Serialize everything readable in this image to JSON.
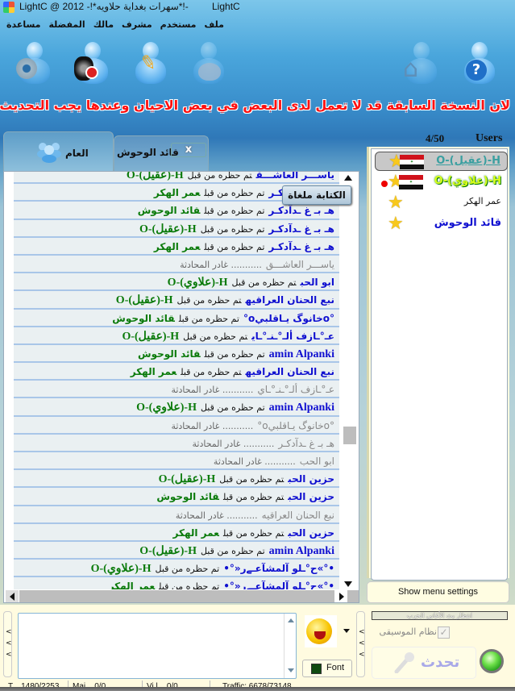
{
  "window": {
    "title": "LightC @ 2012  -!*سهرات بغداية حلاويه*!-",
    "app_name": "LightC"
  },
  "menu": {
    "items": [
      "ملف",
      "مستخدم",
      "مشرف",
      "مالك",
      "المفضلة",
      "مساعدة"
    ]
  },
  "toolbar": {
    "icons": [
      "webcam-icon",
      "speaker-muted-icon",
      "edit-profile-icon",
      "theme-palette-icon",
      "home-icon",
      "help-icon"
    ]
  },
  "marquee": {
    "text": "لان النسخة السابقة قد لا تعمل لدى البعض في بعض الاحيان وعندها يجب التحديث يدويا   اد"
  },
  "tabs": {
    "general_label": "العام",
    "private_label": "قائد الوحوش",
    "close_label": "x"
  },
  "chat": {
    "writing_disabled_label": "الكتابة ملغاة",
    "rows": [
      {
        "who": "ياســـر العاشـــق",
        "action": "تم حظره من قبل",
        "by": "H-(عقيل)-O",
        "left": false
      },
      {
        "who": "هـ بـ غ ـدآدكـر",
        "action": "تم حظره من قبل",
        "by": "عمر الهكر",
        "left": false
      },
      {
        "who": "هـ بـ غ ـدآدكـر",
        "action": "تم حظره من قبل",
        "by": "قائد الوحوش",
        "left": false
      },
      {
        "who": "هـ بـ غ ـدآدكـر",
        "action": "تم حظره من قبل",
        "by": "H-(عقيل)-O",
        "left": false
      },
      {
        "who": "هـ بـ غ ـدآدكـر",
        "action": "تم حظره من قبل",
        "by": "عمر الهكر",
        "left": false
      },
      {
        "who": "ياســـر العاشـــق",
        "action": "........... غادر المحادثة",
        "by": "",
        "left": true
      },
      {
        "who": "ابو الحب",
        "action": "تم حظره من قبل",
        "by": "H-(علاوي)-O",
        "left": false
      },
      {
        "who": "نبع الحنان العراقيه",
        "action": "تم حظره من قبل",
        "by": "H-(عقيل)-O",
        "left": false
      },
      {
        "who": "°oخانوگ يـاقلبيo°",
        "action": "تم حظره من قبل",
        "by": "قائد الوحوش",
        "left": false
      },
      {
        "who": "عـ°ـازف ألـ°ـنـ°ـاي",
        "action": "تم حظره من قبل",
        "by": "H-(عقيل)-O",
        "left": false
      },
      {
        "who": "amin Alpanki",
        "action": "تم حظره من قبل",
        "by": "قائد الوحوش",
        "left": false
      },
      {
        "who": "نبع الحنان العراقيه",
        "action": "تم حظره من قبل",
        "by": "عمر الهكر",
        "left": false
      },
      {
        "who": "عـ°ـازف ألـ°ـنـ°ـاي",
        "action": "........... غادر المحادثة",
        "by": "",
        "left": true
      },
      {
        "who": "amin Alpanki",
        "action": "تم حظره من قبل",
        "by": "H-(علاوي)-O",
        "left": false
      },
      {
        "who": "°oخانوگ يـاقلبيo°",
        "action": "........... غادر المحادثة",
        "by": "",
        "left": true
      },
      {
        "who": "هـ بـ غ ـدآدكـر",
        "action": "........... غادر المحادثة",
        "by": "",
        "left": true
      },
      {
        "who": "ابو الحب",
        "action": "........... غادر المحادثة",
        "by": "",
        "left": true
      },
      {
        "who": "حزين الحب",
        "action": "تم حظره من قبل",
        "by": "H-(عقيل)-O",
        "left": false
      },
      {
        "who": "حزين الحب",
        "action": "تم حظره من قبل",
        "by": "قائد الوحوش",
        "left": false
      },
      {
        "who": "نبع الحنان العراقيه",
        "action": "........... غادر المحادثة",
        "by": "",
        "left": true
      },
      {
        "who": "حزين الحب",
        "action": "تم حظره من قبل",
        "by": "عمر الهكر",
        "left": false
      },
      {
        "who": "amin Alpanki",
        "action": "تم حظره من قبل",
        "by": "H-(عقيل)-O",
        "left": false
      },
      {
        "who": "•°»ح°ـلو آلمشآعـےر«°•",
        "action": "تم حظره من قبل",
        "by": "H-(علاوي)-O",
        "left": false
      },
      {
        "who": "•°»ح°ـلو آلمشآعـےر«°•",
        "action": "تم حظره من قبل",
        "by": "عمر الهكر",
        "left": false
      }
    ]
  },
  "users": {
    "label": "Users",
    "count": "4/50",
    "list": [
      {
        "name": "H-(عقيل)-O",
        "role": "owner",
        "flag": true,
        "selected": true,
        "warning": false
      },
      {
        "name": "H-(علاوي)-O",
        "role": "super",
        "flag": true,
        "selected": false,
        "warning": true
      },
      {
        "name": "عمر الهكر",
        "role": "plain",
        "flag": false,
        "selected": false,
        "warning": false
      },
      {
        "name": "قائد الوحوش",
        "role": "blue",
        "flag": false,
        "selected": false,
        "warning": false
      }
    ],
    "show_menu_label": "Show menu settings"
  },
  "composer": {
    "message_value": "",
    "font_label": "Font",
    "font_color": "#0f4a0f",
    "music_status_text": "انتظار بث الأغاني الحرب",
    "music_label": "نظام الموسيقى",
    "music_checked": true,
    "talk_label": "تحدث",
    "led_color": "#3fc236"
  },
  "statusbar": {
    "segments": [
      "T... 1480/2253",
      "Mai... 0/0",
      "Vi.l... 0/0",
      "Traffic: 6678/73148"
    ]
  }
}
